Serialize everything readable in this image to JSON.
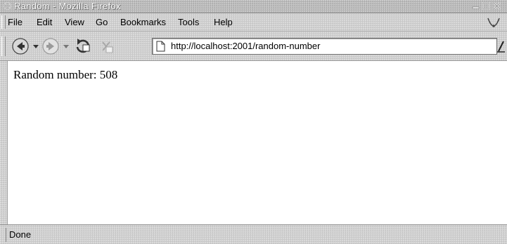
{
  "window": {
    "title": "Random - Mozilla Firefox"
  },
  "menubar": {
    "items": [
      {
        "label": "File"
      },
      {
        "label": "Edit"
      },
      {
        "label": "View"
      },
      {
        "label": "Go"
      },
      {
        "label": "Bookmarks"
      },
      {
        "label": "Tools"
      },
      {
        "label": "Help"
      }
    ]
  },
  "toolbar": {
    "icons": [
      "back-icon",
      "forward-icon",
      "reload-icon",
      "stop-icon",
      "page-icon",
      "go-icon"
    ],
    "url": "http://localhost:2001/random-number"
  },
  "content": {
    "text": "Random number: 508"
  },
  "status": {
    "text": "Done"
  },
  "colors": {
    "chrome": "#cfcfcf",
    "title_bar": "#b9b9b9",
    "content_bg": "#ffffff"
  }
}
